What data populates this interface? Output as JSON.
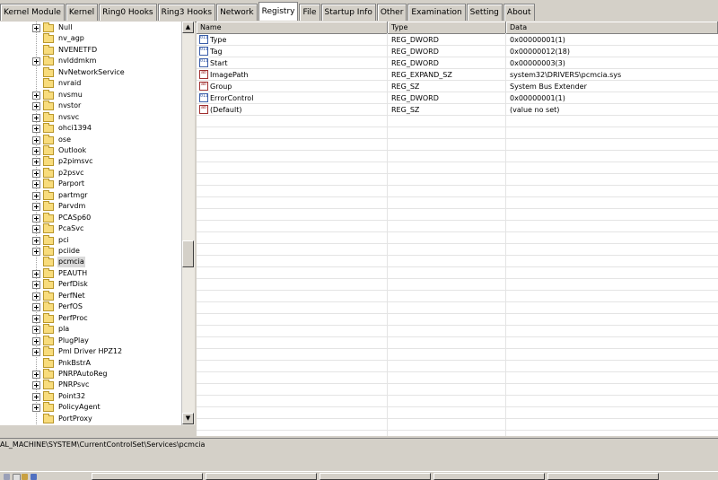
{
  "tabs": [
    "Kernel Module",
    "Kernel",
    "Ring0 Hooks",
    "Ring3 Hooks",
    "Network",
    "Registry",
    "File",
    "Startup Info",
    "Other",
    "Examination",
    "Setting",
    "About"
  ],
  "active_tab": "Registry",
  "tree": {
    "items": [
      {
        "label": "Null",
        "expandable": true
      },
      {
        "label": "nv_agp",
        "expandable": false
      },
      {
        "label": "NVENETFD",
        "expandable": false
      },
      {
        "label": "nvlddmkm",
        "expandable": true
      },
      {
        "label": "NvNetworkService",
        "expandable": false
      },
      {
        "label": "nvraid",
        "expandable": false
      },
      {
        "label": "nvsmu",
        "expandable": true
      },
      {
        "label": "nvstor",
        "expandable": true
      },
      {
        "label": "nvsvc",
        "expandable": true
      },
      {
        "label": "ohci1394",
        "expandable": true
      },
      {
        "label": "ose",
        "expandable": true
      },
      {
        "label": "Outlook",
        "expandable": true
      },
      {
        "label": "p2pimsvc",
        "expandable": true
      },
      {
        "label": "p2psvc",
        "expandable": true
      },
      {
        "label": "Parport",
        "expandable": true
      },
      {
        "label": "partmgr",
        "expandable": true
      },
      {
        "label": "Parvdm",
        "expandable": true
      },
      {
        "label": "PCASp60",
        "expandable": true
      },
      {
        "label": "PcaSvc",
        "expandable": true
      },
      {
        "label": "pci",
        "expandable": true
      },
      {
        "label": "pciide",
        "expandable": true
      },
      {
        "label": "pcmcia",
        "expandable": false,
        "selected": true
      },
      {
        "label": "PEAUTH",
        "expandable": true
      },
      {
        "label": "PerfDisk",
        "expandable": true
      },
      {
        "label": "PerfNet",
        "expandable": true
      },
      {
        "label": "PerfOS",
        "expandable": true
      },
      {
        "label": "PerfProc",
        "expandable": true
      },
      {
        "label": "pla",
        "expandable": true
      },
      {
        "label": "PlugPlay",
        "expandable": true
      },
      {
        "label": "Pml Driver HPZ12",
        "expandable": true
      },
      {
        "label": "PnkBstrA",
        "expandable": false
      },
      {
        "label": "PNRPAutoReg",
        "expandable": true
      },
      {
        "label": "PNRPsvc",
        "expandable": true
      },
      {
        "label": "Point32",
        "expandable": true
      },
      {
        "label": "PolicyAgent",
        "expandable": true
      },
      {
        "label": "PortProxy",
        "expandable": false
      }
    ]
  },
  "values_table": {
    "columns": [
      "Name",
      "Type",
      "Data"
    ],
    "rows": [
      {
        "icon": "reg-dword-icon",
        "name": "Type",
        "type": "REG_DWORD",
        "data": "0x00000001(1)"
      },
      {
        "icon": "reg-dword-icon",
        "name": "Tag",
        "type": "REG_DWORD",
        "data": "0x00000012(18)"
      },
      {
        "icon": "reg-dword-icon",
        "name": "Start",
        "type": "REG_DWORD",
        "data": "0x00000003(3)"
      },
      {
        "icon": "reg-string-icon",
        "name": "ImagePath",
        "type": "REG_EXPAND_SZ",
        "data": "system32\\DRIVERS\\pcmcia.sys"
      },
      {
        "icon": "reg-string-icon",
        "name": "Group",
        "type": "REG_SZ",
        "data": "System Bus Extender"
      },
      {
        "icon": "reg-dword-icon",
        "name": "ErrorControl",
        "type": "REG_DWORD",
        "data": "0x00000001(1)"
      },
      {
        "icon": "reg-string-icon",
        "name": "(Default)",
        "type": "REG_SZ",
        "data": "(value no set)"
      }
    ]
  },
  "path": "AL_MACHINE\\SYSTEM\\CurrentControlSet\\Services\\pcmcia",
  "colors": {
    "panel": "#d4d0c8",
    "folder": "#f8dc7c",
    "dword_icon": "#3a5da8",
    "string_icon": "#a03030"
  }
}
